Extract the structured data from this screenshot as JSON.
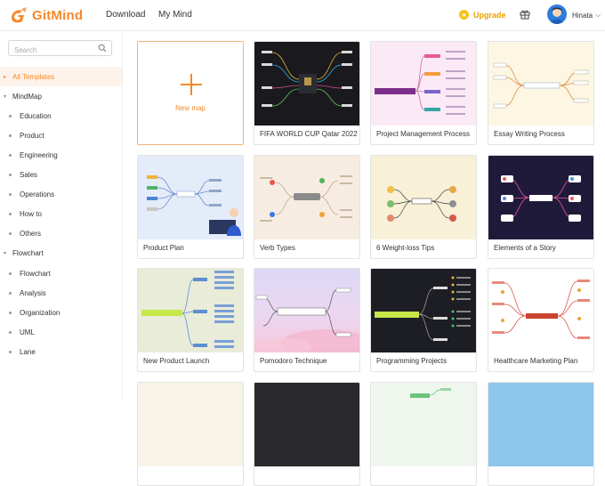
{
  "brand": {
    "name": "GitMind",
    "accent": "#f5892a"
  },
  "nav": {
    "download": "Download",
    "my_mind": "My Mind"
  },
  "header": {
    "upgrade": "Upgrade",
    "username": "Hinata"
  },
  "search": {
    "placeholder": "Search"
  },
  "sidebar": {
    "items": [
      {
        "label": "All Templates",
        "kind": "top",
        "active": true
      },
      {
        "label": "MindMap",
        "kind": "group"
      },
      {
        "label": "Education",
        "kind": "child"
      },
      {
        "label": "Product",
        "kind": "child"
      },
      {
        "label": "Engineering",
        "kind": "child"
      },
      {
        "label": "Sales",
        "kind": "child"
      },
      {
        "label": "Operations",
        "kind": "child"
      },
      {
        "label": "How to",
        "kind": "child"
      },
      {
        "label": "Others",
        "kind": "child"
      },
      {
        "label": "Flowchart",
        "kind": "group"
      },
      {
        "label": "Flowchart",
        "kind": "child"
      },
      {
        "label": "Analysis",
        "kind": "child"
      },
      {
        "label": "Organization",
        "kind": "child"
      },
      {
        "label": "UML",
        "kind": "child"
      },
      {
        "label": "Lane",
        "kind": "child"
      }
    ]
  },
  "new_map": {
    "label": "New map"
  },
  "templates": [
    {
      "title": "FIFA WORLD CUP Qatar 2022"
    },
    {
      "title": "Project Management Process"
    },
    {
      "title": "Essay Writing Process"
    },
    {
      "title": "Product Plan"
    },
    {
      "title": "Verb Types"
    },
    {
      "title": "6 Weight-loss Tips"
    },
    {
      "title": "Elements of a Story"
    },
    {
      "title": "New Product Launch"
    },
    {
      "title": "Pomodoro Technique"
    },
    {
      "title": "Programming Projects"
    },
    {
      "title": "Healthcare Marketing Plan"
    }
  ]
}
